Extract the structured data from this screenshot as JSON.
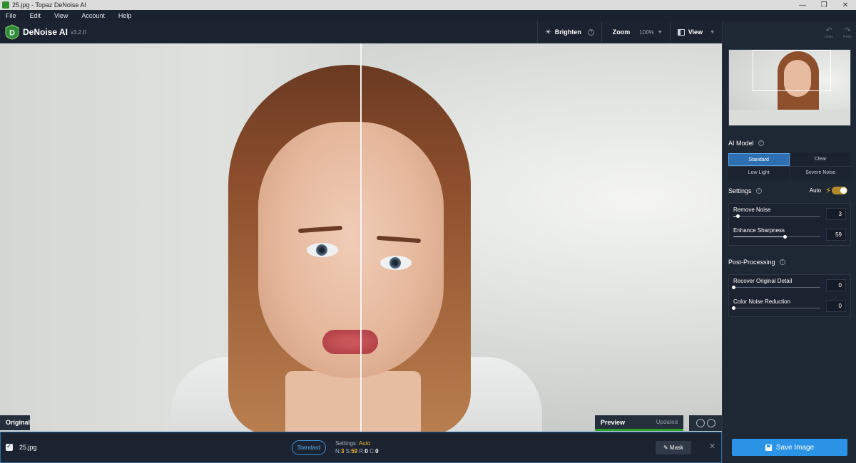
{
  "window": {
    "title": "25.jpg - Topaz DeNoise AI",
    "controls": [
      "—",
      "❐",
      "✕"
    ]
  },
  "menu": [
    "File",
    "Edit",
    "View",
    "Account",
    "Help"
  ],
  "header": {
    "brand": "DeNoise AI",
    "version": "v3.2.0",
    "brighten_label": "Brighten",
    "zoom_label": "Zoom",
    "zoom_value": "100%",
    "view_label": "View"
  },
  "viewer": {
    "original_label": "Original",
    "preview_label": "Preview",
    "updated_label": "Updated"
  },
  "bottom": {
    "filename": "25.jpg",
    "model_pill": "Standard",
    "settings_label": "Settings:",
    "settings_value": "Auto",
    "n_label": "N:",
    "n_value": "3",
    "s_label": "S:",
    "s_value": "59",
    "r_label": "R:",
    "r_value": "0",
    "c_label": "C:",
    "c_value": "0",
    "mask_label": "Mask",
    "close_glyph": "✕"
  },
  "panel": {
    "undo_label": "Undo",
    "redo_label": "Redo",
    "ai_model_title": "AI Model",
    "models": [
      "Standard",
      "Clear",
      "Low Light",
      "Severe Noise"
    ],
    "active_model": "Standard",
    "settings_title": "Settings",
    "auto_label": "Auto",
    "sliders": [
      {
        "label": "Remove Noise",
        "value": "3",
        "fraction": 0.05
      },
      {
        "label": "Enhance Sharpness",
        "value": "59",
        "fraction": 0.59
      }
    ],
    "post_title": "Post-Processing",
    "post_sliders": [
      {
        "label": "Recover Original Detail",
        "value": "0",
        "fraction": 0.0
      },
      {
        "label": "Color Noise Reduction",
        "value": "0",
        "fraction": 0.0
      }
    ],
    "save_label": "Save Image"
  },
  "colors": {
    "accent": "#2a93e6",
    "active_model": "#2e6fb1",
    "preview_bar": "#2ca02c",
    "auto_highlight": "#f0b72e"
  }
}
